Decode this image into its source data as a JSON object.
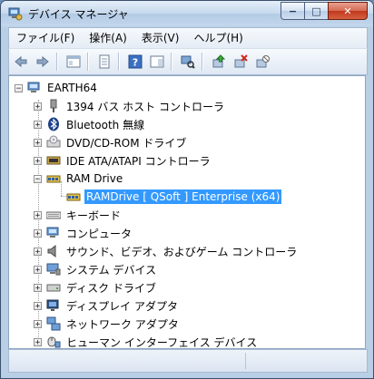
{
  "window": {
    "title": "デバイス マネージャ",
    "controls": {
      "minimize": "−",
      "maximize": "□",
      "close": "✕"
    }
  },
  "menu": [
    {
      "label": "ファイル(F)"
    },
    {
      "label": "操作(A)"
    },
    {
      "label": "表示(V)"
    },
    {
      "label": "ヘルプ(H)"
    }
  ],
  "toolbar": {
    "buttons": [
      "back-icon",
      "forward-icon",
      "properties-panel-icon",
      "document-icon",
      "help-icon",
      "console-tree-icon",
      "scan-hardware-icon",
      "update-driver-icon",
      "uninstall-icon",
      "disable-icon"
    ]
  },
  "tree": {
    "root": {
      "label": "EARTH64",
      "expander": "−"
    },
    "nodes": [
      {
        "label": "1394 バス ホスト コントローラ",
        "expander": "+",
        "icon": "bus-controller-icon"
      },
      {
        "label": "Bluetooth 無線",
        "expander": "+",
        "icon": "bluetooth-icon"
      },
      {
        "label": "DVD/CD-ROM ドライブ",
        "expander": "+",
        "icon": "cdrom-drive-icon"
      },
      {
        "label": "IDE ATA/ATAPI コントローラ",
        "expander": "+",
        "icon": "ide-controller-icon"
      },
      {
        "label": "RAM Drive",
        "expander": "−",
        "icon": "ram-drive-icon"
      },
      {
        "label": "RAMDrive [ QSoft ] Enterprise (x64)",
        "expander": "",
        "icon": "ram-drive-icon",
        "child": true,
        "selected": true
      },
      {
        "label": "キーボード",
        "expander": "+",
        "icon": "keyboard-icon"
      },
      {
        "label": "コンピュータ",
        "expander": "+",
        "icon": "computer-icon"
      },
      {
        "label": "サウンド、ビデオ、およびゲーム コントローラ",
        "expander": "+",
        "icon": "speaker-icon"
      },
      {
        "label": "システム デバイス",
        "expander": "+",
        "icon": "system-device-icon"
      },
      {
        "label": "ディスク ドライブ",
        "expander": "+",
        "icon": "disk-drive-icon"
      },
      {
        "label": "ディスプレイ アダプタ",
        "expander": "+",
        "icon": "display-adapter-icon"
      },
      {
        "label": "ネットワーク アダプタ",
        "expander": "+",
        "icon": "network-adapter-icon"
      },
      {
        "label": "ヒューマン インターフェイス デバイス",
        "expander": "+",
        "icon": "hid-icon"
      }
    ]
  },
  "colors": {
    "selection": "#3399ff",
    "titlebar": "#c6d9ee",
    "close": "#c0381d"
  }
}
